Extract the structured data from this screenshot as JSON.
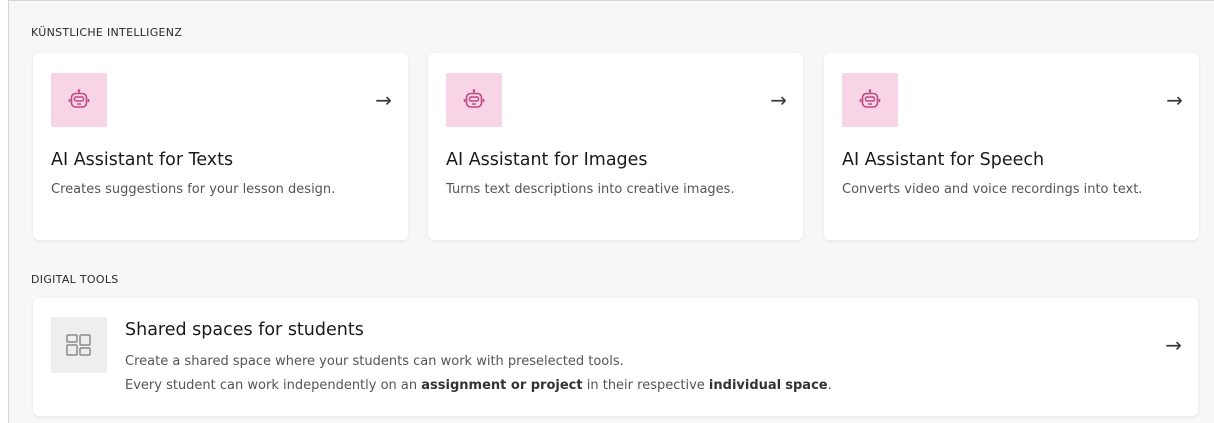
{
  "sections": {
    "ai": {
      "label": "KÜNSTLICHE INTELLIGENZ",
      "cards": [
        {
          "title": "AI Assistant for Texts",
          "description": "Creates suggestions for your lesson design.",
          "icon": "robot-icon",
          "arrow": "→"
        },
        {
          "title": "AI Assistant for Images",
          "description": "Turns text descriptions into creative images.",
          "icon": "robot-icon",
          "arrow": "→"
        },
        {
          "title": "AI Assistant for Speech",
          "description": "Converts video and voice recordings into text.",
          "icon": "robot-icon",
          "arrow": "→"
        }
      ]
    },
    "tools": {
      "label": "DIGITAL TOOLS",
      "card": {
        "title": "Shared spaces for students",
        "line1": "Create a shared space where your students can work with preselected tools.",
        "line2_parts": [
          "Every student can work independently on an ",
          "assignment or project",
          " in their respective ",
          "individual",
          " ",
          "space",
          "."
        ],
        "icon": "layout-grid-icon",
        "arrow": "→"
      }
    }
  },
  "colors": {
    "ai_icon_bg": "#f7d4e6",
    "ai_icon_fg": "#c2477f",
    "tool_icon_bg": "#eeeeee",
    "tool_icon_fg": "#8a8a8a"
  }
}
